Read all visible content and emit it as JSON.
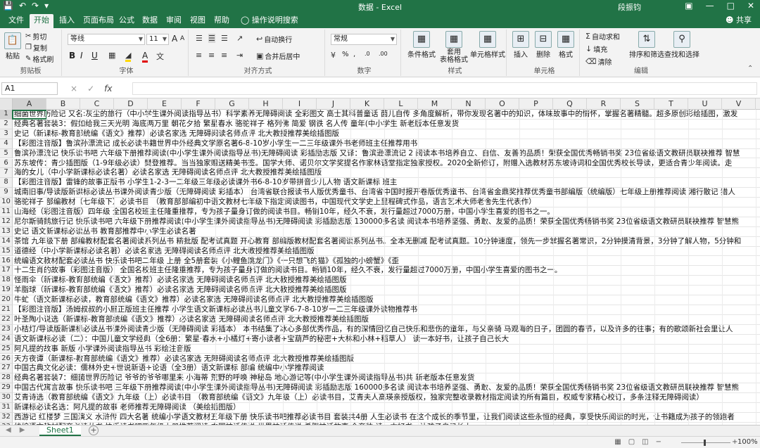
{
  "window": {
    "title": "数据 - Excel",
    "user": "段振钧",
    "qa_icons": [
      "save-icon",
      "undo-icon",
      "redo-icon",
      "customize-icon"
    ],
    "controls": [
      "ribbon-display-icon",
      "minimize-icon",
      "maximize-icon",
      "close-icon"
    ]
  },
  "tabs": [
    "文件",
    "开始",
    "插入",
    "页面布局",
    "公式",
    "数据",
    "审阅",
    "视图",
    "帮助",
    "操作说明搜索"
  ],
  "share": "共享",
  "ribbon": {
    "clipboard": {
      "label": "剪贴板",
      "paste": "粘贴",
      "cut": "剪切",
      "copy": "复制",
      "format_painter": "格式刷"
    },
    "font": {
      "label": "字体",
      "font_name": "等线",
      "font_size": "11",
      "bold": "B",
      "italic": "I",
      "underline": "U",
      "grow": "A",
      "shrink": "A",
      "font_color_letter": "A"
    },
    "alignment": {
      "label": "对齐方式",
      "wrap": "自动换行",
      "merge": "合并后居中"
    },
    "number": {
      "label": "数字",
      "format": "常规",
      "percent": "%",
      "comma": ",",
      "inc": ".0",
      "dec": ".00"
    },
    "styles": {
      "label": "样式",
      "cond": "条件格式",
      "table": "套用\n表格格式",
      "cell_styles": "单元格样式"
    },
    "cells": {
      "label": "单元格",
      "insert": "插入",
      "delete": "删除",
      "format": "格式"
    },
    "editing": {
      "label": "编辑",
      "autosum": "自动求和",
      "fill": "填充",
      "clear": "清除",
      "sort": "排序和筛选",
      "find": "查找和选择"
    }
  },
  "formula_bar": {
    "name_box": "A1",
    "cancel": "×",
    "enter": "✓",
    "fx": "fx"
  },
  "columns": [
    "A",
    "B",
    "C",
    "D",
    "E",
    "F",
    "G",
    "H",
    "I",
    "J",
    "K",
    "L",
    "M",
    "N",
    "O",
    "P",
    "Q",
    "R",
    "S",
    "T",
    "U",
    "V"
  ],
  "rows": [
    {
      "n": "1",
      "text": "细菌世界历险记 又名:灰尘的旅行（中小学生课外阅读指导丛书）科学素养无障碍阅读 全彩图文 高士其科普童话 菌儿自传 多角度解析，带你发现名著中的知识，体味故事中的情怀，掌握名著精髓。超多原创彩绘插图，激发"
    },
    {
      "n": "2",
      "text": "经典名著套装3：假如给我三天光明 海底两万里 朝花夕拾 繁星春水 骆驼祥子 格列佛 简爱 钢铁 名人传 童年(中小学生 新老版本任意发货"
    },
    {
      "n": "3",
      "text": "史记（新课标-教育部统编《语文》推荐）必读名家选 无障碍阅读名师点评 北大教授推荐美绘插图版"
    },
    {
      "n": "4",
      "text": "【彩图注音版】鲁滨孙漂流记 成长必读书籍世界中外经典文学原名著6-8-10岁小学生一二三年级课外书老师班主任推荐用书"
    },
    {
      "n": "5",
      "text": "鲁滨孙漂流记 快乐读书吧 六年级下册推荐阅读(中小学生课外阅读指导丛书)无障碍阅读 彩插励志版 又译：鲁滨逊漂流记 2 阅读本书培养自立、自信、友善的品质！荣获全国优秀畅销书奖 23位省级语文教研员联袂推荐 智慧"
    },
    {
      "n": "6",
      "text": "苏东坡传：青少插图版（1-9年级必读）樊登推荐。当当独家赠送精美书签。国学大师、诺贝尔文学奖提名作家林语堂指定独家授权。2020全新修订，附赠入选教材苏东坡诗词和全国优秀校长导读，更适合青少年阅读。走"
    },
    {
      "n": "7",
      "text": "海的女儿（中小学新课标必读名著）必读名家选 无障碍阅读名师点评 北大教授推荐美绘插图版"
    },
    {
      "n": "8",
      "text": "【彩图注音版】雷锋的故事正版书 小学生1-2-3一二年级三年级必读课外书6-8-10岁带拼音少儿人物 语文新课标 班主"
    },
    {
      "n": "9",
      "text": "城南旧事/导读版新课标必读丛书课外阅读青少版（无障碍阅读 彩插本） 台湾省联合报读书人版优秀童书、台湾省中国时报开卷版优秀童书、台湾省金鼎奖推荐优秀童书部编版（统编版）七年级上册推荐阅读 湘行散记 猎人"
    },
    {
      "n": "10",
      "text": "骆驼祥子 部编教材（七年级下）必读书目 （教育部部编初中语文教材七年级下指定阅读图书，中国现代文学史上里程碑式作品，语言艺术大师老舍先生代表作）"
    },
    {
      "n": "11",
      "text": "山海经（彩图注音版）四年级 全国名校班主任隆重推荐，专为孩子量身订做的阅读书目。畅销10年，经久不衰，发行量超过7000万册，中国小学生喜爱的图书之一。"
    },
    {
      "n": "12",
      "text": "尼尔斯骑鹅旅行记 快乐读书吧 六年级下册推荐阅读(中小学生课外阅读指导丛书)无障碍阅读 彩插励志版 130000多名读 阅读本书培养坚强、勇敢、友爱的品质！荣获全国优秀畅销书奖 23位省级语文教研员联袂推荐 智慧熊"
    },
    {
      "n": "13",
      "text": "史记 语文新课标必读丛书 教育部推荐中小学生必读名著"
    },
    {
      "n": "14",
      "text": "茶馆 九年级下册 部编教材配套名著阅读系列丛书 精批版 配考试真题 开心教育 部编版教材配套名著阅读系列丛书。全本无删减 配考试真题。10分钟速度，领先一步掌握名著常识，2分钟摸清背景，3分钟了解人物，5分钟和"
    },
    {
      "n": "15",
      "text": "道德经（中小学新课标必读名著）必读名家选 无障碍阅读名师点评 北大教授推荐美绘插图版"
    },
    {
      "n": "16",
      "text": "统编语文教材配套必读丛书 快乐读书吧二年级 上册 全5册套装《小鲤鱼跳龙门》《一只想飞的猫》《孤独的小螃蟹》《歪"
    },
    {
      "n": "17",
      "text": "十二生肖的故事（彩图注音版） 全国名校班主任隆重推荐，专为孩子量身订做的阅读书目。畅销10年，经久不衰，发行量超过7000万册，中国小学生喜爱的图书之一。"
    },
    {
      "n": "18",
      "text": "怪雨伞（新课标-教育部统编《语文》推荐）必读名家选 无障碍阅读名师点评 北大教授推荐美绘插图版"
    },
    {
      "n": "19",
      "text": "羊脂球（新课标-教育部统编《语文》推荐）必读名家选 无障碍阅读名师点评 北大教授推荐美绘插图版"
    },
    {
      "n": "20",
      "text": "牛虻（语文新课标必读，教育部统编《语文》推荐）必读名家选 无障碍阅读名师点评 北大教授推荐美绘插图版"
    },
    {
      "n": "21",
      "text": "【彩图注音版】汤姆叔叔的小屋正版班主任推荐 小学生语文新课标必读丛书儿童文学6-7-8-10岁一二三年级课外读物推荐书"
    },
    {
      "n": "22",
      "text": "叶圣陶小说选（新课标-教育部统编《语文》推荐）必读名家选 无障碍阅读名师点评 北大教授推荐美绘插图版"
    },
    {
      "n": "23",
      "text": "小桔灯/导读版新课标必读丛书课外阅读青少版（无障碍阅读 彩插本） 本书结集了冰心多部优秀作品，有的深情回忆自己快乐和悲伤的童年，与父亲骑 马观海的日子，团圆的春节，以及许多的往事；有的歌颂新社会里让人"
    },
    {
      "n": "24",
      "text": "语文新课标必读（二）：中国儿童文学经典（全6册：繁星·春水+小橘灯+寄小读者+宝葫芦的秘密+大林和小林+稻草人） 读一本好书，让孩子自己长大"
    },
    {
      "n": "25",
      "text": "阿凡提的故事 新版 小学课外阅读指导丛书 彩绘注音版"
    },
    {
      "n": "26",
      "text": "天方夜谭（新课标-教育部统编《语文》推荐）必读名家选 无障碍阅读名师点评 北大教授推荐美绘插图版"
    },
    {
      "n": "27",
      "text": "中国古典文化必读：儒林外史+世说新语+论语（全3册）语文新课标 部编 统编中小学推荐阅读"
    },
    {
      "n": "28",
      "text": "经典名著套装7：细菌世界历险记 爷爷的爷爷哪里来 小海蒂 荒野的呼唤 神秘岛 地心游记等(中小学生课外阅读指导丛书)共 新老版本任意发货"
    },
    {
      "n": "29",
      "text": "中国古代寓言故事 快乐读书吧 三年级下册推荐阅读(中小学生课外阅读指导丛书)无障碍阅读 彩插励志版 160000多名读 阅读本书培养坚强、勇敢、友爱的品质！荣获全国优秀畅销书奖 23位省级语文教研员联袂推荐 智慧熊"
    },
    {
      "n": "30",
      "text": "艾青诗选（教育部统编《语文》九年级（上）必读书目 （教育部统编《语文》九年级（上）必读书目，艾青夫人高瑛亲授版权，独家完整收录教材指定阅读的所有篇目，权威专家精心校订，多条注释无障碍阅读）"
    },
    {
      "n": "31",
      "text": "新课标必读名选：阿凡提的故事 老师推荐无障碍阅读 （美绘插图版）"
    },
    {
      "n": "32",
      "text": "西游记 红楼梦 三国演义 水浒传 四大名著 统编小学语文教材五年级下册 快乐读书吧推荐必读书目 套装共4册 人生必读书 在这个成长的季节里，让我们阅读这些永恒的经典，享受快乐阅读的时光，让书籍成为孩子的领跑者"
    },
    {
      "n": "33",
      "text": "统编语文教材配套必读丛书 快乐读书吧四年级上册推荐阅读 中国神话传说 世界神话传说 希腊神话故事 全套装 读一本好书，让孩子自己长大"
    }
  ],
  "sheet_tab": "Sheet1",
  "zoom": "100%"
}
